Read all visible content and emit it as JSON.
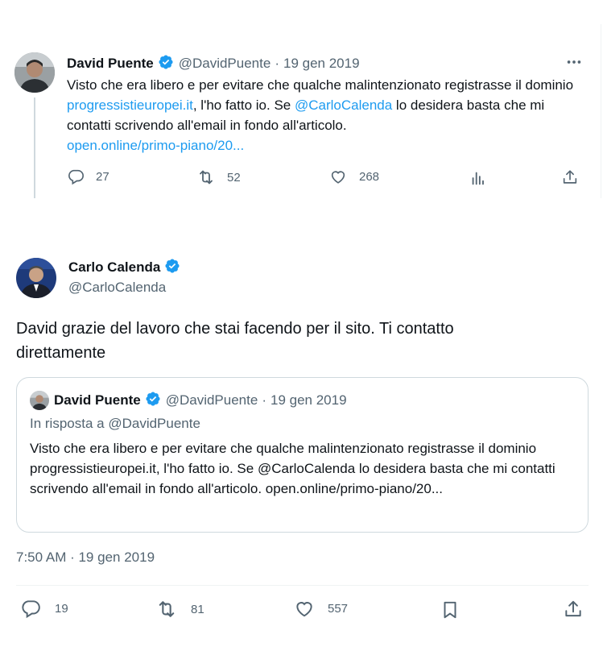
{
  "reply_tweet": {
    "author_name": "David Puente",
    "handle": "@DavidPuente",
    "separator": "·",
    "date": "19 gen 2019",
    "text_1": "Visto che era libero e per evitare che qualche malintenzionato registrasse il dominio ",
    "link_domain": "progressistieuropei.it",
    "text_2": ", l'ho fatto io. Se ",
    "mention": "@CarloCalenda",
    "text_3": " lo desidera basta che mi contatti scrivendo all'email in fondo all'articolo.",
    "link_url": "open.online/primo-piano/20...",
    "stats": {
      "replies": "27",
      "retweets": "52",
      "likes": "268"
    }
  },
  "main_tweet": {
    "author_name": "Carlo Calenda",
    "handle": "@CarloCalenda",
    "text": "David grazie del lavoro che stai facendo per il sito. Ti contatto direttamente",
    "timestamp": "7:50 AM · 19 gen 2019",
    "stats": {
      "replies": "19",
      "retweets": "81",
      "likes": "557"
    }
  },
  "quoted_tweet": {
    "author_name": "David Puente",
    "handle": "@DavidPuente",
    "separator": "·",
    "date": "19 gen 2019",
    "in_reply_to": "In risposta a @DavidPuente",
    "text": "Visto che era libero e per evitare che qualche malintenzionato registrasse il dominio progressistieuropei.it, l'ho fatto io. Se @CarloCalenda lo desidera basta che mi contatti scrivendo all'email in fondo all'articolo. open.online/primo-piano/20..."
  },
  "icons": {
    "verified": "verified-badge-icon",
    "more": "more-icon",
    "reply": "reply-icon",
    "retweet": "retweet-icon",
    "like": "heart-icon",
    "views": "analytics-icon",
    "share": "share-icon",
    "bookmark": "bookmark-icon"
  },
  "colors": {
    "accent": "#1d9bf0",
    "text": "#0f1419",
    "muted": "#536471",
    "border": "#cfd9de"
  }
}
